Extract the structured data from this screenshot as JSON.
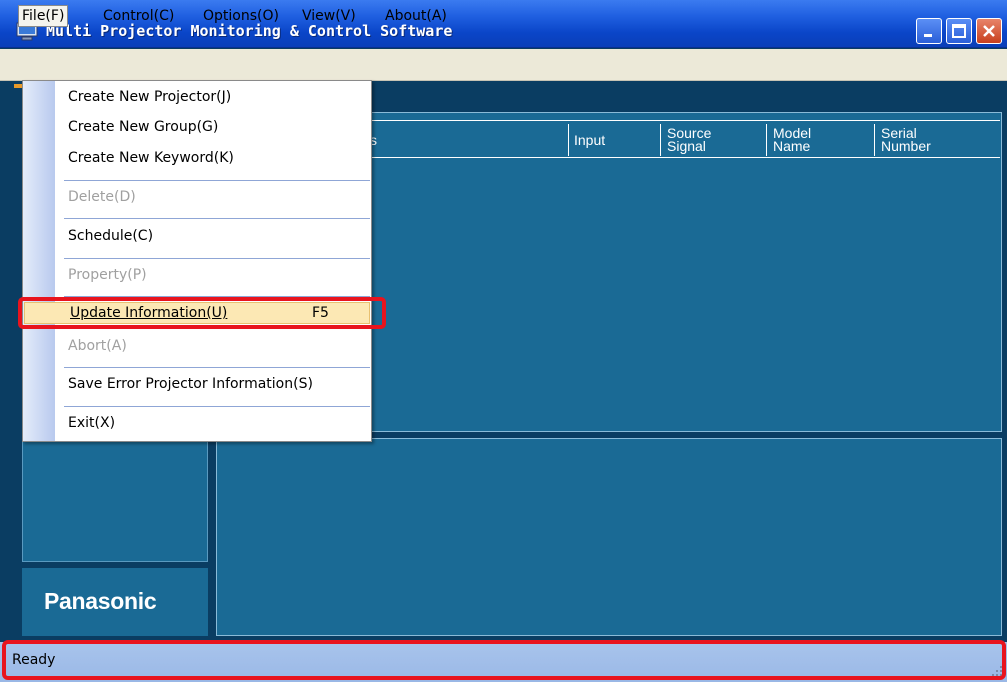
{
  "window": {
    "title": "Multi Projector Monitoring & Control Software"
  },
  "menubar": {
    "file": "File(F)",
    "control": "Control(C)",
    "options": "Options(O)",
    "view": "View(V)",
    "about": "About(A)"
  },
  "file_menu": {
    "items": [
      {
        "label": "Create New Projector(J)",
        "enabled": true
      },
      {
        "label": "Create New Group(G)",
        "enabled": true
      },
      {
        "label": "Create New Keyword(K)",
        "enabled": true
      },
      {
        "label": "Delete(D)",
        "enabled": false
      },
      {
        "label": "Schedule(C)",
        "enabled": true
      },
      {
        "label": "Property(P)",
        "enabled": false
      },
      {
        "label": "Update Information(U)",
        "enabled": true,
        "shortcut": "F5",
        "highlighted": true
      },
      {
        "label": "Abort(A)",
        "enabled": false
      },
      {
        "label": "Save Error Projector Information(S)",
        "enabled": true
      },
      {
        "label": "Exit(X)",
        "enabled": true
      }
    ]
  },
  "list": {
    "columns": {
      "partial": "s",
      "input": "Input",
      "source_signal": "Source\nSignal",
      "model_name": "Model\nName",
      "serial_number": "Serial\nNumber"
    }
  },
  "logo": "Panasonic",
  "status": {
    "text": "Ready"
  },
  "colors": {
    "highlight_box": "#e8141e",
    "panel": "#1a6a95",
    "background": "#0a3d62"
  }
}
